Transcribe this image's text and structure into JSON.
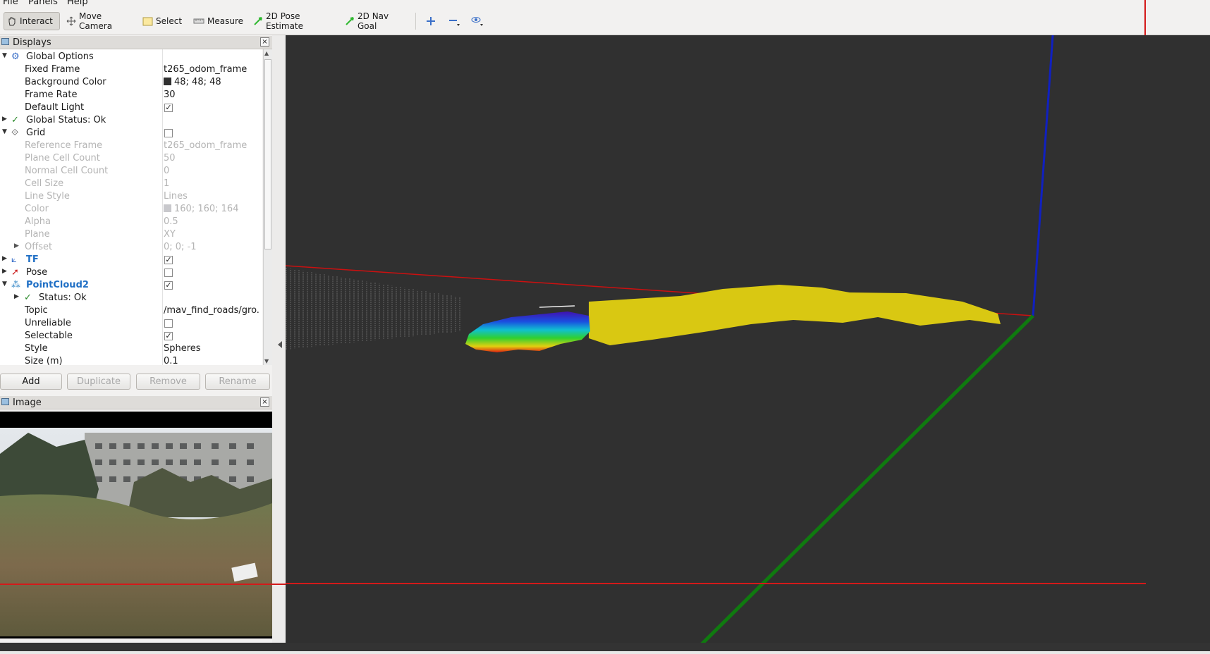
{
  "menu": {
    "file": "File",
    "panels": "Panels",
    "help": "Help"
  },
  "toolbar": {
    "interact": "Interact",
    "move_camera": "Move Camera",
    "select": "Select",
    "measure": "Measure",
    "pose_estimate": "2D Pose Estimate",
    "nav_goal": "2D Nav Goal"
  },
  "displays": {
    "title": "Displays",
    "global_options": {
      "label": "Global Options",
      "fixed_frame": {
        "name": "Fixed Frame",
        "value": "t265_odom_frame"
      },
      "background_color": {
        "name": "Background Color",
        "value": "48; 48; 48"
      },
      "frame_rate": {
        "name": "Frame Rate",
        "value": "30"
      },
      "default_light": {
        "name": "Default Light"
      }
    },
    "global_status": "Global Status: Ok",
    "grid": {
      "label": "Grid",
      "reference_frame": {
        "name": "Reference Frame",
        "value": "t265_odom_frame"
      },
      "plane_cell_count": {
        "name": "Plane Cell Count",
        "value": "50"
      },
      "normal_cell_count": {
        "name": "Normal Cell Count",
        "value": "0"
      },
      "cell_size": {
        "name": "Cell Size",
        "value": "1"
      },
      "line_style": {
        "name": "Line Style",
        "value": "Lines"
      },
      "color": {
        "name": "Color",
        "value": "160; 160; 164"
      },
      "alpha": {
        "name": "Alpha",
        "value": "0.5"
      },
      "plane": {
        "name": "Plane",
        "value": "XY"
      },
      "offset": {
        "name": "Offset",
        "value": "0; 0; -1"
      }
    },
    "tf": "TF",
    "pose": "Pose",
    "pointcloud2": {
      "label": "PointCloud2",
      "status": "Status: Ok",
      "topic": {
        "name": "Topic",
        "value": "/mav_find_roads/gro."
      },
      "unreliable": {
        "name": "Unreliable"
      },
      "selectable": {
        "name": "Selectable"
      },
      "style": {
        "name": "Style",
        "value": "Spheres"
      },
      "size": {
        "name": "Size (m)",
        "value": "0.1"
      }
    },
    "buttons": {
      "add": "Add",
      "duplicate": "Duplicate",
      "remove": "Remove",
      "rename": "Rename"
    }
  },
  "image_panel": {
    "title": "Image"
  },
  "colors": {
    "viewport_bg": "#303030",
    "x_axis": "#cc1010",
    "y_axis": "#0f7a0f",
    "z_axis": "#1020c0",
    "cloud_yellow": "#d9c812",
    "accent_blue": "#1f6fc5"
  }
}
